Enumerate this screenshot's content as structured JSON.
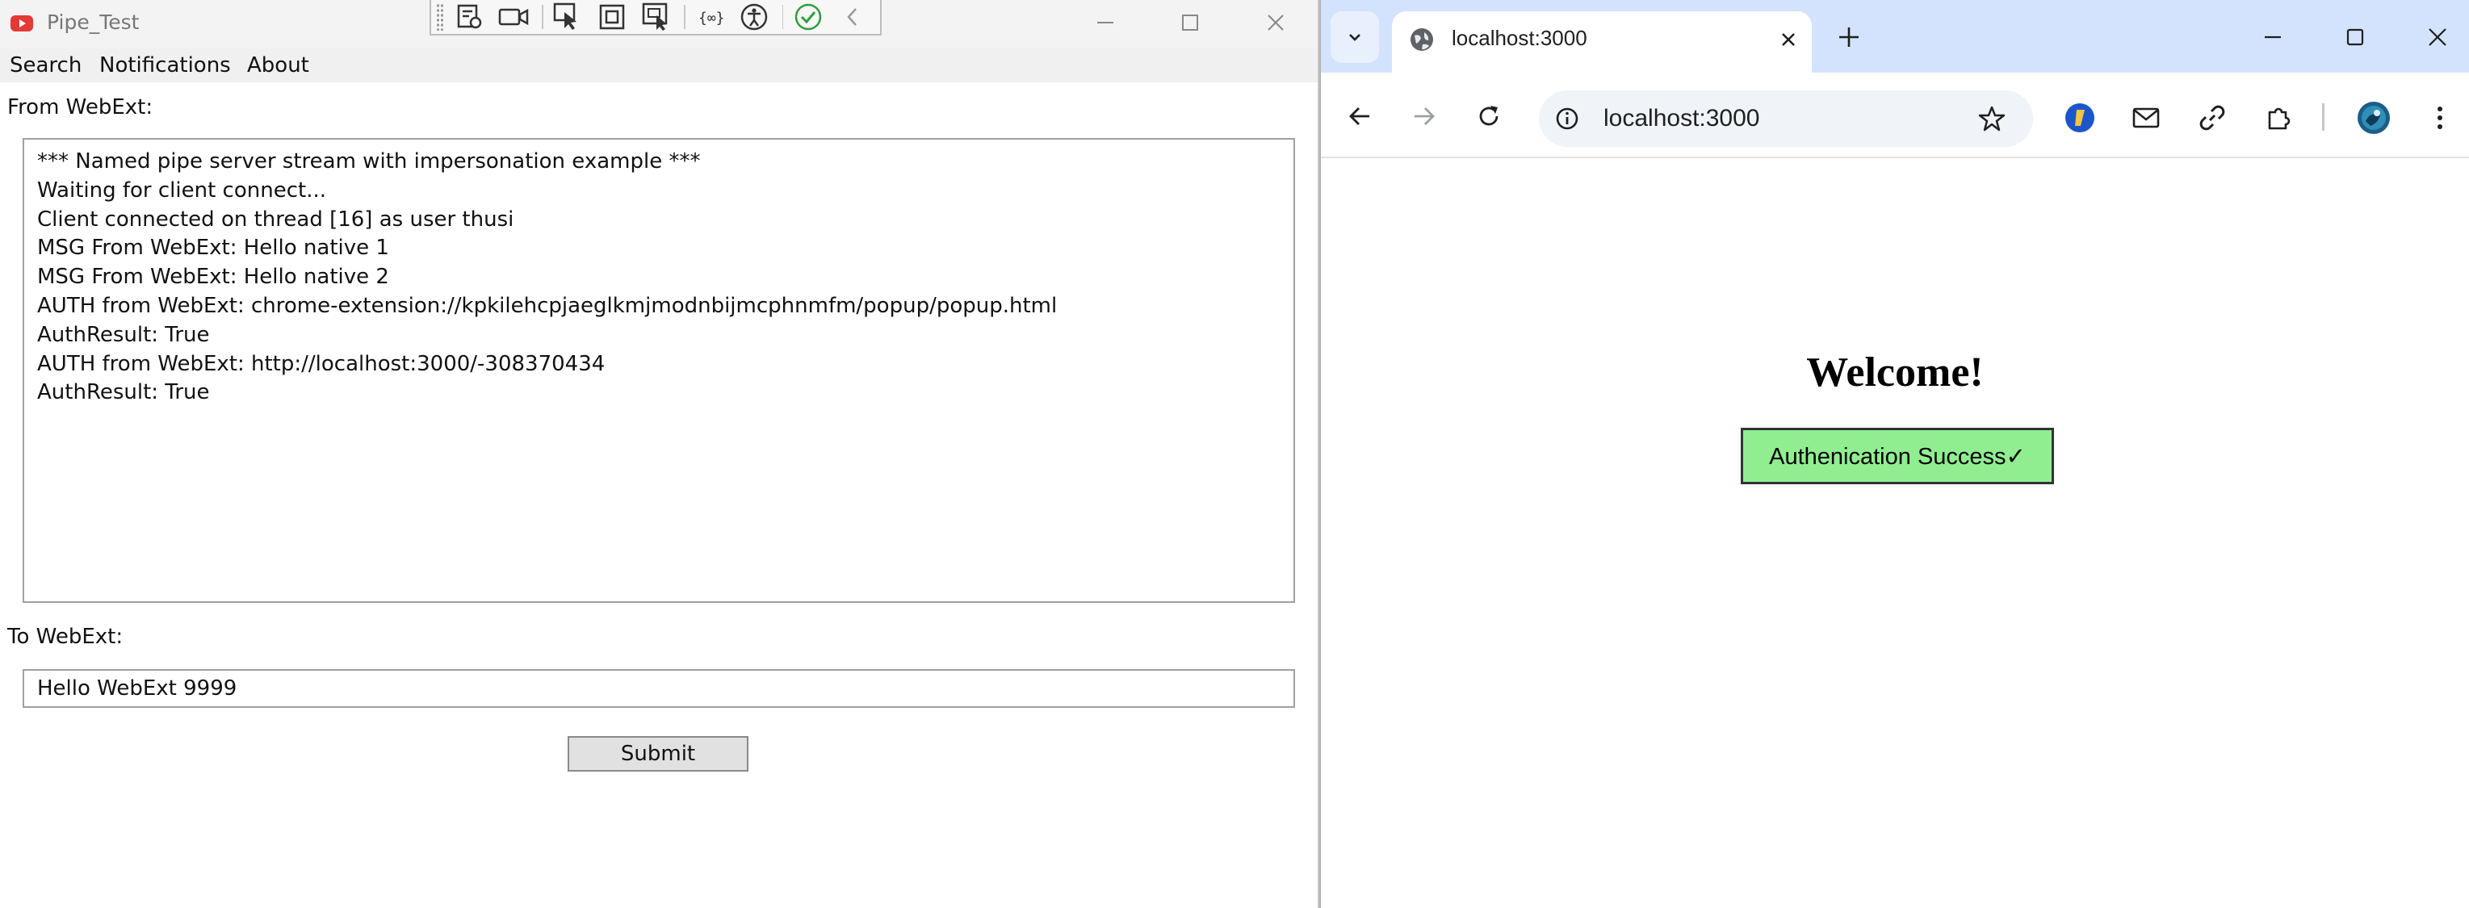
{
  "app": {
    "title": "Pipe_Test",
    "menu": [
      "Search",
      "Notifications",
      "About"
    ],
    "from_label": "From WebExt:",
    "log_lines": [
      "*** Named pipe server stream with impersonation example ***",
      "Waiting for client connect...",
      "Client connected on thread [16] as user thusi",
      "MSG From WebExt: Hello native 1",
      "MSG From WebExt: Hello native 2",
      "AUTH from WebExt: chrome-extension://kpkilehcpjaeglkmjmodnbijmcphnmfm/popup/popup.html",
      "AuthResult: True",
      "AUTH from WebExt: http://localhost:3000/-308370434",
      "AuthResult: True"
    ],
    "to_label": "To WebExt:",
    "to_value": "Hello WebExt 9999",
    "submit_label": "Submit",
    "debug_toolbar_icons": [
      "live-visual-tree-icon",
      "video-icon",
      "select-element-icon",
      "display-layout-adorners-icon",
      "track-focus-icon",
      "binding-failures-icon",
      "accessibility-icon",
      "checkmark-icon",
      "collapse-icon"
    ]
  },
  "browser": {
    "tab_title": "localhost:3000",
    "url": "localhost:3000",
    "page": {
      "heading": "Welcome!",
      "button_label": "Authenication Success✓",
      "button_color": "#90ee90"
    }
  },
  "colors": {
    "app_icon_red": "#e53935",
    "chrome_tabstrip": "#d3e3fd",
    "omnibox_bg": "#f0f3f8"
  }
}
